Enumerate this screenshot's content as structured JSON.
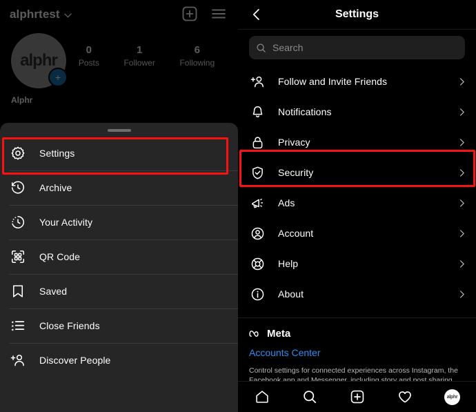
{
  "left_phone": {
    "header": {
      "username": "alphrtest",
      "chevron": "chevron-down",
      "new_post_icon": "plus-square-icon",
      "menu_icon": "hamburger-menu-icon"
    },
    "profile": {
      "avatar_text": "alphr",
      "add_badge": "+",
      "display_name": "Alphr",
      "stats": [
        {
          "number": "0",
          "label": "Posts"
        },
        {
          "number": "1",
          "label": "Follower"
        },
        {
          "number": "6",
          "label": "Following"
        }
      ]
    },
    "sheet": {
      "items": [
        {
          "label": "Settings",
          "icon": "gear-icon",
          "highlighted": true
        },
        {
          "label": "Archive",
          "icon": "archive-clock-icon",
          "highlighted": false
        },
        {
          "label": "Your Activity",
          "icon": "activity-clock-icon",
          "highlighted": false
        },
        {
          "label": "QR Code",
          "icon": "qr-code-icon",
          "highlighted": false
        },
        {
          "label": "Saved",
          "icon": "bookmark-icon",
          "highlighted": false
        },
        {
          "label": "Close Friends",
          "icon": "close-friends-list-icon",
          "highlighted": false
        },
        {
          "label": "Discover People",
          "icon": "add-person-icon",
          "highlighted": false
        }
      ]
    }
  },
  "right_phone": {
    "header": {
      "back_icon": "chevron-left-icon",
      "title": "Settings"
    },
    "search": {
      "icon": "search-icon",
      "placeholder": "Search",
      "value": ""
    },
    "settings_items": [
      {
        "label": "Follow and Invite Friends",
        "icon": "add-person-icon",
        "highlighted": false
      },
      {
        "label": "Notifications",
        "icon": "bell-icon",
        "highlighted": false
      },
      {
        "label": "Privacy",
        "icon": "lock-icon",
        "highlighted": false
      },
      {
        "label": "Security",
        "icon": "shield-check-icon",
        "highlighted": true
      },
      {
        "label": "Ads",
        "icon": "megaphone-icon",
        "highlighted": false
      },
      {
        "label": "Account",
        "icon": "account-circle-icon",
        "highlighted": false
      },
      {
        "label": "Help",
        "icon": "life-ring-icon",
        "highlighted": false
      },
      {
        "label": "About",
        "icon": "info-circle-icon",
        "highlighted": false
      }
    ],
    "meta_section": {
      "brand_icon": "meta-infinity-icon",
      "brand_name": "Meta",
      "link_label": "Accounts Center",
      "description": "Control settings for connected experiences across Instagram, the Facebook app and Messenger, including story and post sharing and loggi..."
    },
    "bottom_nav": [
      {
        "name": "home-icon"
      },
      {
        "name": "search-icon"
      },
      {
        "name": "plus-square-icon"
      },
      {
        "name": "heart-icon"
      },
      {
        "name": "profile-avatar"
      }
    ],
    "bottom_nav_avatar_text": "alphr"
  },
  "annotation": {
    "highlight_color": "#f81212"
  }
}
